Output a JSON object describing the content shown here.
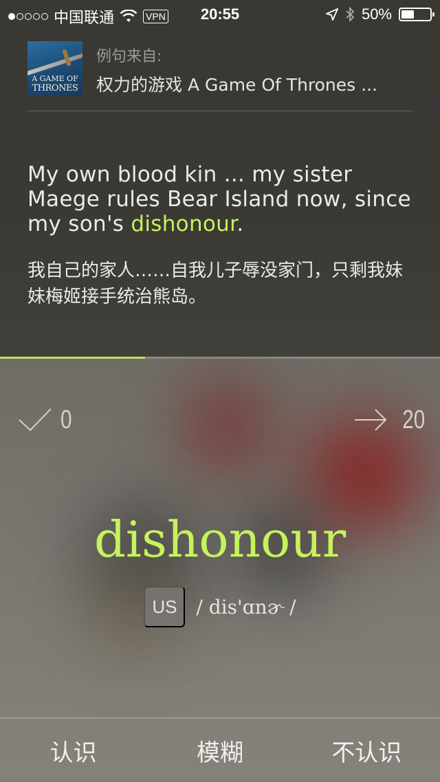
{
  "status_bar": {
    "signal_dots_filled": 1,
    "signal_dots_total": 5,
    "carrier": "中国联通",
    "vpn": "VPN",
    "time": "20:55",
    "battery": "50%",
    "battery_level": 0.5
  },
  "source": {
    "label": "例句来自:",
    "title": "权力的游戏 A Game Of Thrones ...",
    "cover_line1": "A GAME OF",
    "cover_line2": "THRONES"
  },
  "sentence": {
    "en_before": "My own blood kin ... my sister Maege rules Bear Island now, since my son's ",
    "en_highlight": "dishonour",
    "en_after": ".",
    "zh": "我自己的家人……自我儿子辱没家门，只剩我妹妹梅姬接手统治熊岛。"
  },
  "progress": {
    "fraction": 0.33
  },
  "counters": {
    "known": "0",
    "remaining": "20"
  },
  "word": {
    "text": "dishonour",
    "accent": "US",
    "phonetic": "/ dis'ɑnɚ /"
  },
  "actions": {
    "know": "认识",
    "vague": "模糊",
    "unknown": "不认识"
  },
  "colors": {
    "highlight": "#c6f25e",
    "progress": "#b9e35a"
  }
}
